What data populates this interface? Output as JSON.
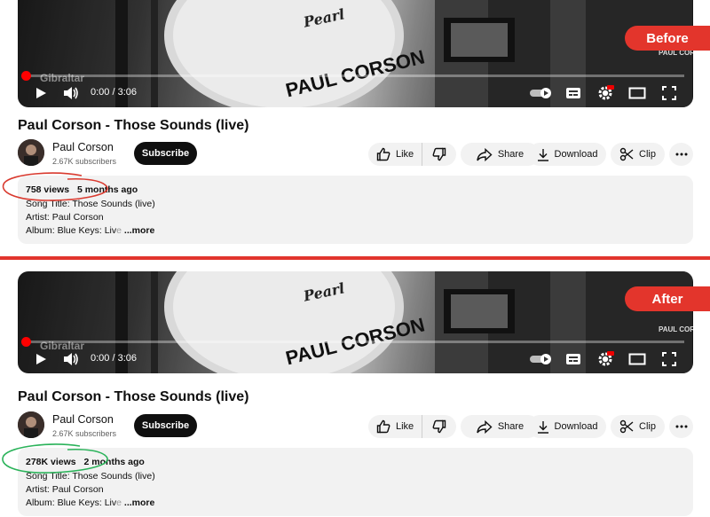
{
  "before": {
    "badge": "Before",
    "player": {
      "time": "0:00 / 3:06"
    },
    "title": "Paul Corson - Those Sounds (live)",
    "channel": {
      "name": "Paul Corson",
      "subscribers": "2.67K subscribers"
    },
    "subscribe_label": "Subscribe",
    "actions": {
      "like": "Like",
      "share": "Share",
      "download": "Download",
      "clip": "Clip"
    },
    "description": {
      "views": "758 views",
      "age": "5 months ago",
      "line1": "Song Title: Those Sounds (live)",
      "line2": "Artist: Paul Corson",
      "line3_prefix": "Album: Blue Keys: Liv",
      "line3_fade": "e",
      "more": "...more"
    },
    "circle_color": "#d93a2f"
  },
  "after": {
    "badge": "After",
    "player": {
      "time": "0:00 / 3:06"
    },
    "title": "Paul Corson - Those Sounds (live)",
    "channel": {
      "name": "Paul Corson",
      "subscribers": "2.67K subscribers"
    },
    "subscribe_label": "Subscribe",
    "actions": {
      "like": "Like",
      "share": "Share",
      "download": "Download",
      "clip": "Clip"
    },
    "description": {
      "views": "278K views",
      "age": "2 months ago",
      "line1": "Song Title: Those Sounds (live)",
      "line2": "Artist: Paul Corson",
      "line3_prefix": "Album: Blue Keys: Liv",
      "line3_fade": "e",
      "more": "...more"
    },
    "circle_color": "#2bb35a"
  },
  "video_overlay": {
    "drum_brand": "Pearl",
    "drum_name": "PAUL CORSON",
    "watermark": "PAUL CORSON",
    "stand_brand": "Gibraltar"
  },
  "colors": {
    "accent_red": "#e3352c",
    "progress_red": "#ff0000"
  },
  "icons": [
    "play-icon",
    "volume-icon",
    "autoplay-toggle-icon",
    "subtitles-icon",
    "settings-icon",
    "hd-badge-icon",
    "theater-mode-icon",
    "fullscreen-icon",
    "like-icon",
    "dislike-icon",
    "share-icon",
    "download-icon",
    "clip-icon",
    "more-options-icon"
  ]
}
